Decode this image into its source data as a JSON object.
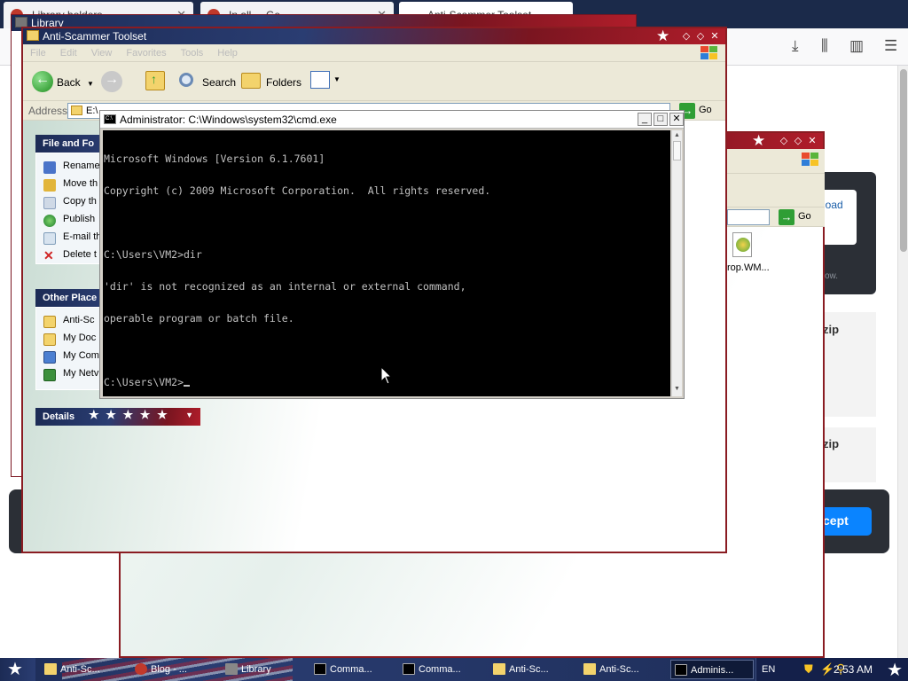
{
  "browser": {
    "tabs": [
      {
        "label": "Library holders..."
      },
      {
        "label": "In all ... Ge..."
      },
      {
        "label": "Anti-Scammer Toolset"
      }
    ],
    "library_window_title": "Library"
  },
  "page_behind": {
    "download_label": "load",
    "dim_text": "ow.",
    "zip1": "zip",
    "zip2": "zip",
    "accept_label": "cept"
  },
  "explorer_back": {
    "file_label": "rop.WM...",
    "go_label": "Go"
  },
  "explorer": {
    "title": "Anti-Scammer Toolset",
    "menus": [
      "File",
      "Edit",
      "View",
      "Favorites",
      "Tools",
      "Help"
    ],
    "toolbar": {
      "back_label": "Back",
      "search_label": "Search",
      "folders_label": "Folders"
    },
    "address_label": "Address",
    "address_value": "E:\\",
    "go_label": "Go",
    "file_tasks_title": "File and Fo",
    "file_tasks": [
      {
        "label": "Rename"
      },
      {
        "label": "Move th"
      },
      {
        "label": "Copy th"
      },
      {
        "label": "Publish"
      },
      {
        "label": "E-mail th"
      },
      {
        "label": "Delete t"
      }
    ],
    "other_places_title": "Other Place",
    "other_places": [
      {
        "label": "Anti-Sc"
      },
      {
        "label": "My Doc"
      },
      {
        "label": "My Com"
      },
      {
        "label": "My Netv"
      }
    ],
    "details_title": "Details"
  },
  "cmd": {
    "title": "Administrator: C:\\Windows\\system32\\cmd.exe",
    "lines": [
      "Microsoft Windows [Version 6.1.7601]",
      "Copyright (c) 2009 Microsoft Corporation.  All rights reserved.",
      "",
      "C:\\Users\\VM2>dir",
      "'dir' is not recognized as an internal or external command,",
      "operable program or batch file.",
      "",
      "C:\\Users\\VM2>"
    ]
  },
  "taskbar": {
    "items": [
      {
        "label": "Anti-Sc..."
      },
      {
        "label": "Blog - ..."
      },
      {
        "label": "Library"
      },
      {
        "label": "Comma..."
      },
      {
        "label": "Comma..."
      },
      {
        "label": "Anti-Sc..."
      },
      {
        "label": "Anti-Sc..."
      },
      {
        "label": "Adminis..."
      }
    ],
    "language": "EN",
    "clock": "2:53 AM"
  },
  "colors": {
    "theme_navy": "#1c2b55",
    "theme_red": "#b01d2a",
    "console_bg": "#000000",
    "console_text": "#c0c0c0"
  }
}
